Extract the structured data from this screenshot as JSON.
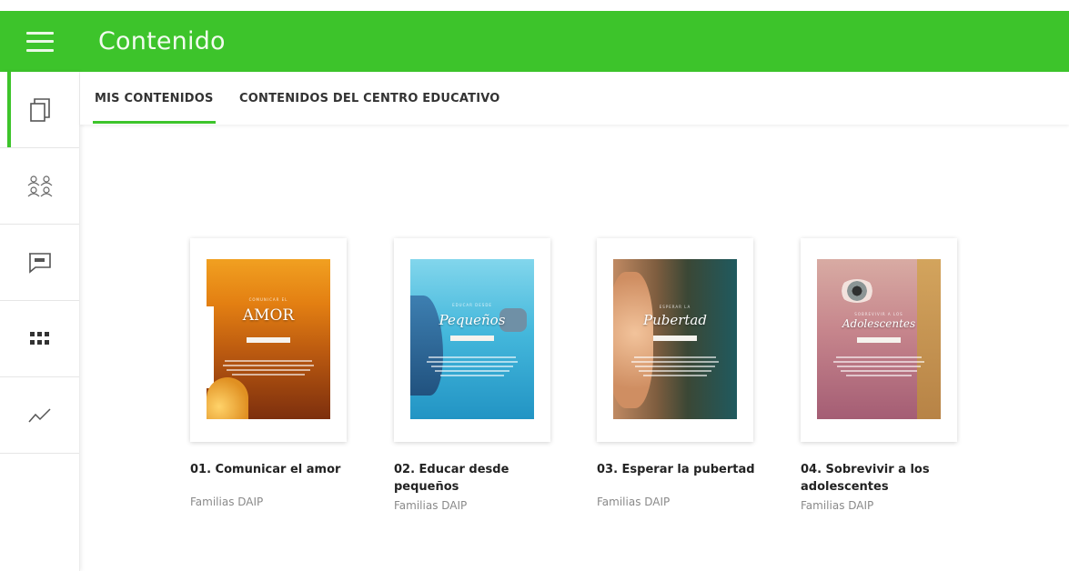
{
  "header": {
    "title": "Contenido",
    "accent_color": "#3dc42b"
  },
  "sidebar": {
    "items": [
      {
        "icon": "copy-pages-icon",
        "active": true
      },
      {
        "icon": "group-users-icon",
        "active": false
      },
      {
        "icon": "chat-message-icon",
        "active": false
      },
      {
        "icon": "apps-grid-icon",
        "active": false
      },
      {
        "icon": "trend-chart-icon",
        "active": false
      }
    ]
  },
  "tabs": [
    {
      "label": "MIS CONTENIDOS",
      "active": true
    },
    {
      "label": "CONTENIDOS DEL CENTRO EDUCATIVO",
      "active": false
    }
  ],
  "contents": [
    {
      "title": "01. Comunicar el amor",
      "author": "Familias DAIP",
      "cover_title": "AMOR"
    },
    {
      "title": "02. Educar desde pequeños",
      "author": "Familias DAIP",
      "cover_title": "Pequeños"
    },
    {
      "title": "03. Esperar la pubertad",
      "author": "Familias DAIP",
      "cover_title": "Pubertad"
    },
    {
      "title": "04. Sobrevivir a los adolescentes",
      "author": "Familias DAIP",
      "cover_title": "Adolescentes"
    }
  ]
}
